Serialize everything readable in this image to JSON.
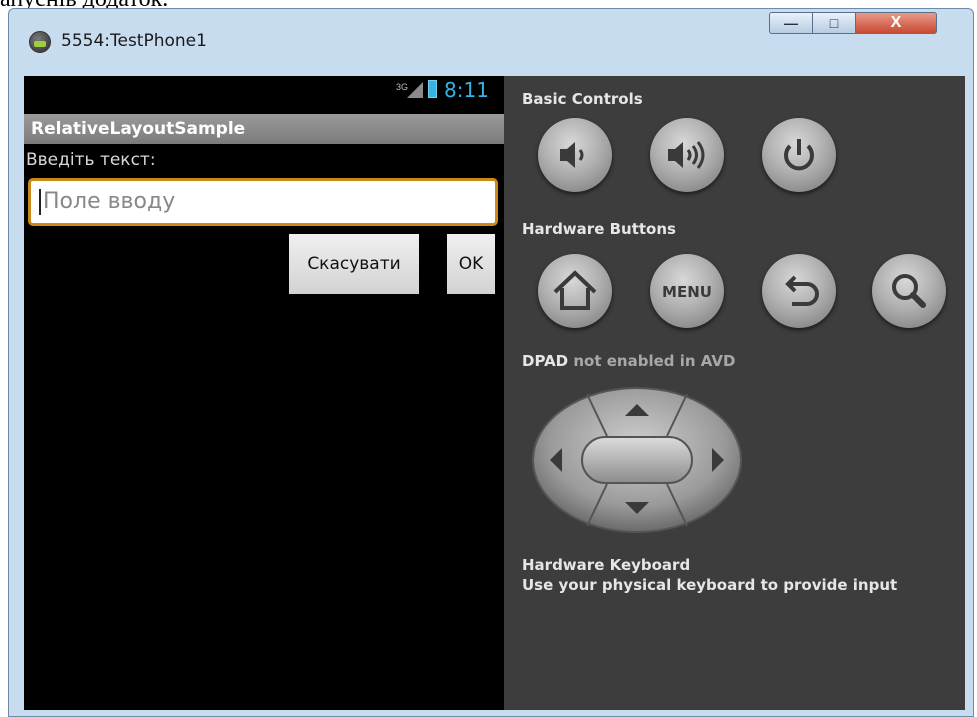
{
  "document": {
    "top_text": "апуснів додаток."
  },
  "window": {
    "title": "5554:TestPhone1",
    "controls": {
      "minimize": "—",
      "maximize": "□",
      "close": "X"
    }
  },
  "status_bar": {
    "network": "3G",
    "time": "8:11"
  },
  "app": {
    "title": "RelativeLayoutSample",
    "prompt": "Введіть текст:",
    "input": {
      "value": "",
      "placeholder": "Поле вводу"
    },
    "cancel_label": "Скасувати",
    "ok_label": "OK"
  },
  "panel": {
    "basic_controls_label": "Basic Controls",
    "hardware_buttons_label": "Hardware Buttons",
    "dpad_label_bold": "DPAD",
    "dpad_label_rest": " not enabled in AVD",
    "keyboard_title": "Hardware Keyboard",
    "keyboard_hint": "Use your physical keyboard to provide input",
    "menu_button_text": "MENU",
    "buttons": [
      "volume-down-icon",
      "volume-up-icon",
      "power-icon",
      "home-icon",
      "menu-icon",
      "back-icon",
      "search-icon"
    ]
  },
  "colors": {
    "accent": "#33b5e5",
    "field_border": "#c98a1b",
    "panel_bg": "#3d3d3d"
  }
}
